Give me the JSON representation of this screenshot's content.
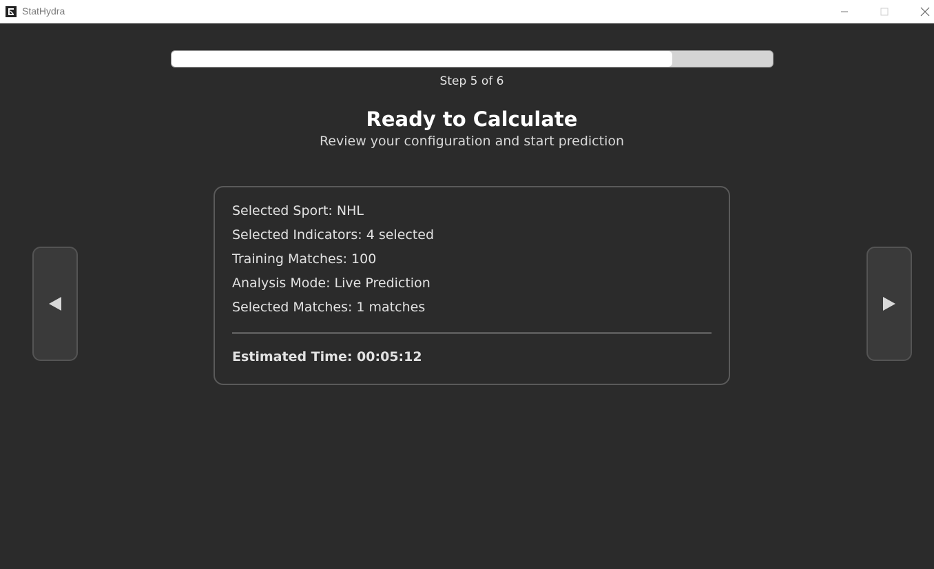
{
  "window": {
    "title": "StatHydra",
    "icons": {
      "app": "app-logo-icon",
      "minimize": "minimize-icon",
      "maximize": "maximize-icon",
      "close": "close-icon"
    }
  },
  "progress": {
    "current_step": 5,
    "total_steps": 6,
    "fraction": 0.833,
    "label": "Step 5 of 6"
  },
  "header": {
    "title": "Ready to Calculate",
    "subtitle": "Review your configuration and start prediction"
  },
  "summary": {
    "lines": [
      "Selected Sport: NHL",
      "Selected Indicators: 4 selected",
      "Training Matches: 100",
      "Analysis Mode: Live Prediction",
      "Selected Matches: 1 matches"
    ],
    "estimated_time": "Estimated Time: 00:05:12"
  },
  "navigation": {
    "prev_icon": "left-triangle-icon",
    "next_icon": "right-triangle-icon"
  },
  "colors": {
    "background": "#2b2b2b",
    "progress_fill": "#ffffff",
    "progress_track": "#d4d4d4",
    "text_primary": "#ffffff",
    "text_secondary": "#e2e2e2"
  }
}
